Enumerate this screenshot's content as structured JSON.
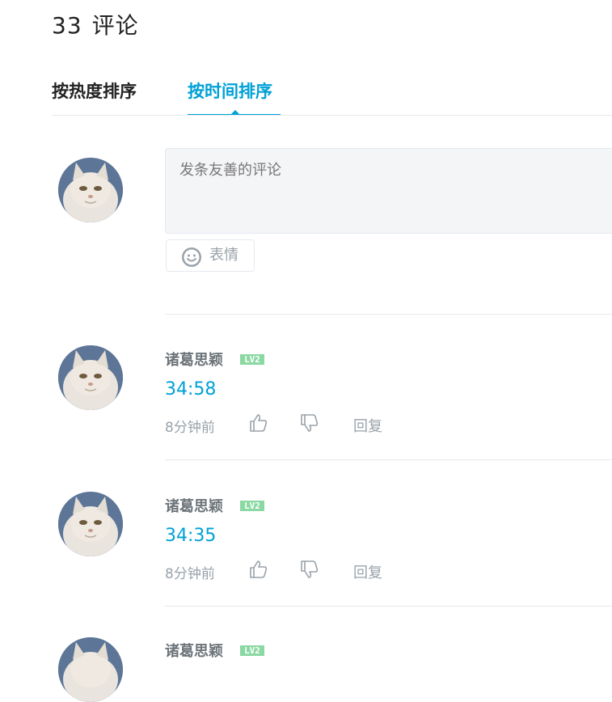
{
  "header": {
    "count": "33",
    "title": "评论"
  },
  "tabs": [
    {
      "label": "按热度排序"
    },
    {
      "label": "按时间排序"
    }
  ],
  "composer": {
    "placeholder": "发条友善的评论",
    "emoji_label": "表情",
    "emoji_icon": "smiley-icon",
    "avatar_icon": "cat-avatar"
  },
  "comments": [
    {
      "user": "诸葛思颖",
      "level": "LV2",
      "text": "34:58",
      "time": "8分钟前",
      "reply": "回复"
    },
    {
      "user": "诸葛思颖",
      "level": "LV2",
      "text": "34:35",
      "time": "8分钟前",
      "reply": "回复"
    },
    {
      "user": "诸葛思颖",
      "level": "LV2"
    }
  ],
  "colors": {
    "accent": "#00a1d6",
    "level_badge": "#8ad8a2",
    "muted": "#99a2aa",
    "divider": "#e5e9ef"
  }
}
